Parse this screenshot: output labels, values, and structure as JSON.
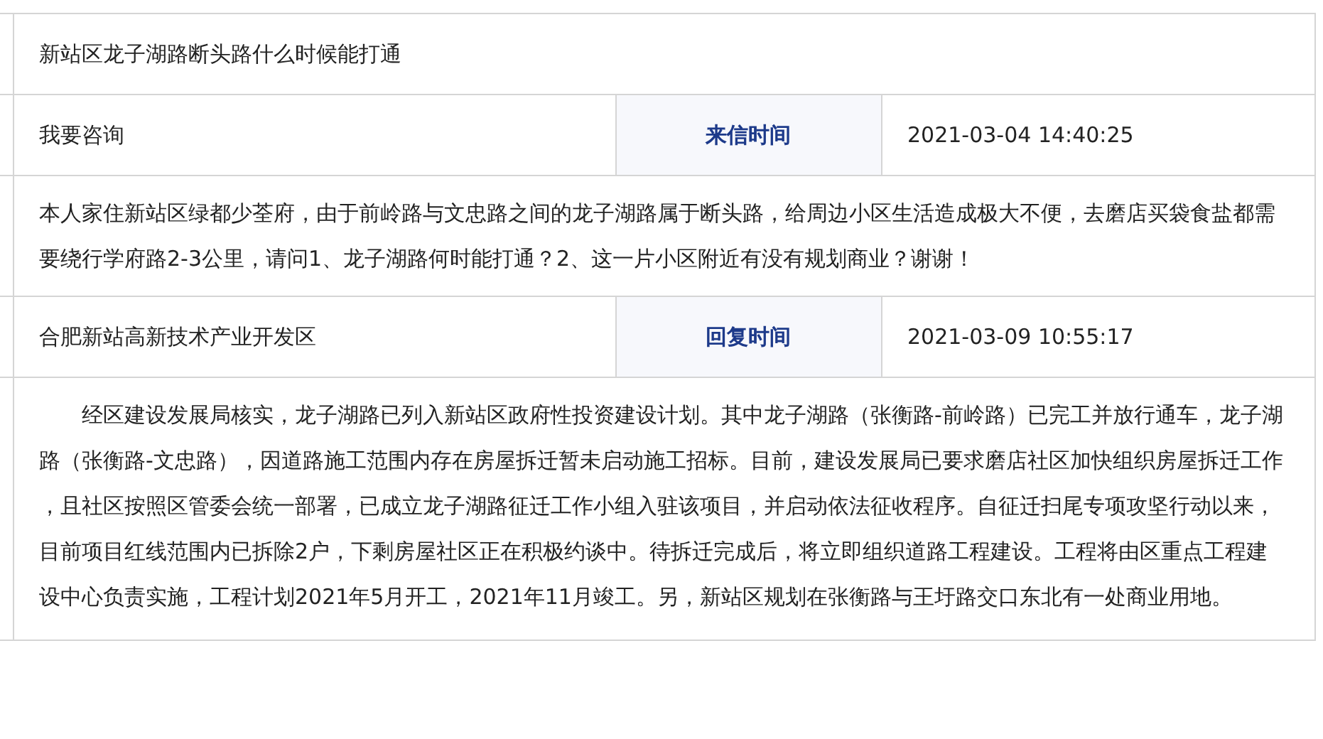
{
  "title": "新站区龙子湖路断头路什么时候能打通",
  "letter": {
    "type": "我要咨询",
    "time_label": "来信时间",
    "time": "2021-03-04 14:40:25",
    "content": "本人家住新站区绿都少荃府，由于前岭路与文忠路之间的龙子湖路属于断头路，给周边小区生活造成极大不便，去磨店买袋食盐都需要绕行学府路2-3公里，请问1、龙子湖路何时能打通？2、这一片小区附近有没有规划商业？谢谢！"
  },
  "reply": {
    "department": "合肥新站高新技术产业开发区",
    "time_label": "回复时间",
    "time": "2021-03-09 10:55:17",
    "content": "经区建设发展局核实，龙子湖路已列入新站区政府性投资建设计划。其中龙子湖路（张衡路-前岭路）已完工并放行通车，龙子湖路（张衡路-文忠路），因道路施工范围内存在房屋拆迁暂未启动施工招标。目前，建设发展局已要求磨店社区加快组织房屋拆迁工作，且社区按照区管委会统一部署，已成立龙子湖路征迁工作小组入驻该项目，并启动依法征收程序。自征迁扫尾专项攻坚行动以来，目前项目红线范围内已拆除2户，下剩房屋社区正在积极约谈中。待拆迁完成后，将立即组织道路工程建设。工程将由区重点工程建设中心负责实施，工程计划2021年5月开工，2021年11月竣工。另，新站区规划在张衡路与王圩路交口东北有一处商业用地。"
  }
}
